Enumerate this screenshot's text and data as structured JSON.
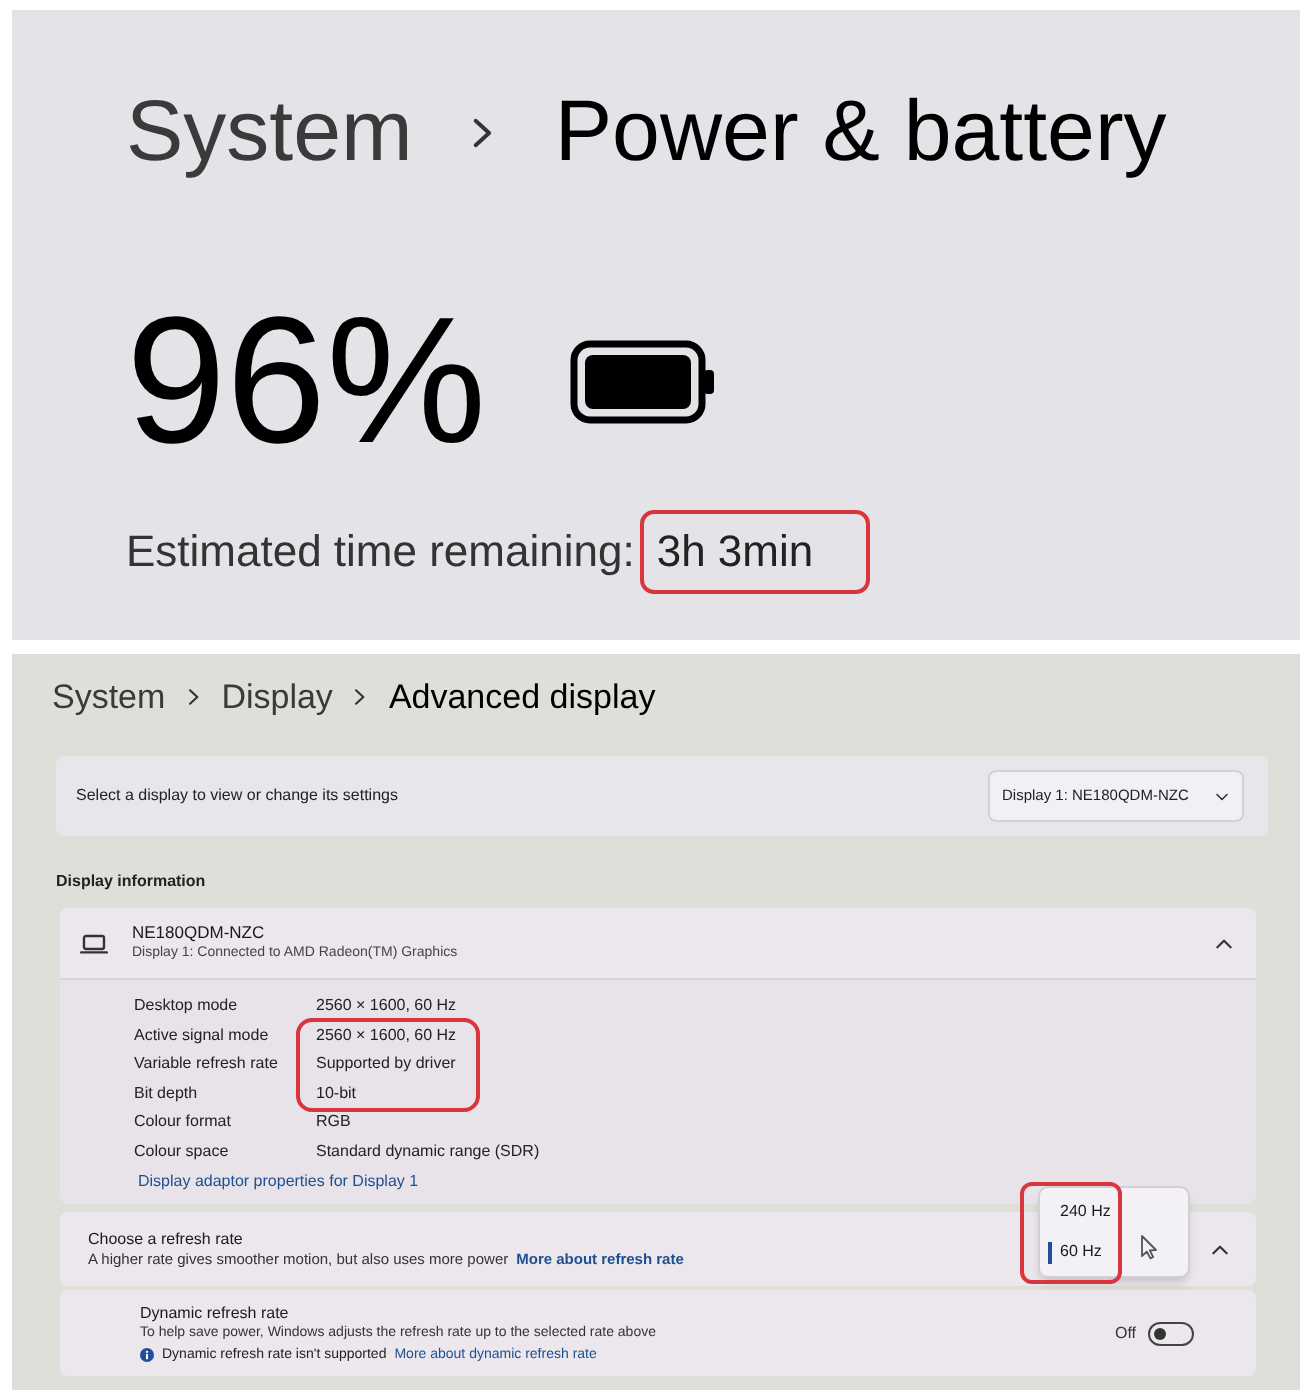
{
  "power_page": {
    "breadcrumb": [
      {
        "label": "System",
        "current": false
      },
      {
        "label": "Power & battery",
        "current": true
      }
    ],
    "battery_percent": "96%",
    "estimate": {
      "label": "Estimated time remaining:",
      "value": "3h 3min",
      "highlighted": true
    }
  },
  "display_page": {
    "breadcrumb": [
      {
        "label": "System",
        "current": false
      },
      {
        "label": "Display",
        "current": false
      },
      {
        "label": "Advanced display",
        "current": true
      }
    ],
    "select_display": {
      "label": "Select a display to view or change its settings",
      "dropdown": "Display 1: NE180QDM-NZC"
    },
    "section_title": "Display information",
    "display_card": {
      "name": "NE180QDM-NZC",
      "subtitle": "Display 1: Connected to AMD Radeon(TM) Graphics",
      "expanded": true,
      "details": [
        {
          "label": "Desktop mode",
          "value": "2560 × 1600, 60 Hz",
          "highlighted": false
        },
        {
          "label": "Active signal mode",
          "value": "2560 × 1600, 60 Hz",
          "highlighted": true
        },
        {
          "label": "Variable refresh rate",
          "value": "Supported by driver",
          "highlighted": true
        },
        {
          "label": "Bit depth",
          "value": "10-bit",
          "highlighted": true
        },
        {
          "label": "Colour format",
          "value": "RGB",
          "highlighted": false
        },
        {
          "label": "Colour space",
          "value": "Standard dynamic range (SDR)",
          "highlighted": false
        }
      ],
      "link": "Display adaptor properties for Display 1"
    },
    "refresh_rate": {
      "title": "Choose a refresh rate",
      "description": "A higher rate gives smoother motion, but also uses more power",
      "link": "More about refresh rate",
      "expanded": true,
      "menu": {
        "highlighted": true,
        "options": [
          {
            "label": "240 Hz",
            "selected": false
          },
          {
            "label": "60 Hz",
            "selected": true
          }
        ]
      }
    },
    "dynamic_refresh": {
      "title": "Dynamic refresh rate",
      "description": "To help save power, Windows adjusts the refresh rate up to the selected rate above",
      "notice": "Dynamic refresh rate isn't supported",
      "link": "More about dynamic refresh rate",
      "toggle": {
        "label": "Off",
        "on": false
      }
    }
  }
}
